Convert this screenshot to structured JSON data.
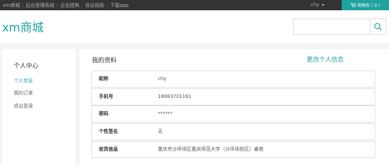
{
  "topbar": {
    "links": [
      "xm商城",
      "后台管理系统",
      "企业团购",
      "协议规则",
      "下载app"
    ],
    "user": "chy",
    "cart_label": "购物车 ( 0 )"
  },
  "header": {
    "logo": "xm商城",
    "search": {
      "value": "",
      "placeholder": ""
    }
  },
  "sidebar": {
    "title": "个人中心",
    "items": [
      {
        "label": "个人信息",
        "active": true
      },
      {
        "label": "我的订单",
        "active": false
      },
      {
        "label": "退出登录",
        "active": false
      }
    ]
  },
  "profile": {
    "title": "我的资料",
    "edit_label": "更改个人信息",
    "fields": [
      {
        "label": "昵称",
        "value": "chy"
      },
      {
        "label": "手机号",
        "value": "18883701161"
      },
      {
        "label": "密码",
        "value": "******"
      },
      {
        "label": "个性签名",
        "value": "无"
      },
      {
        "label": "收货信息",
        "value": "重庆市沙坪坝区重庆师范大学（沙坪坝校区）睿苑"
      }
    ]
  },
  "colors": {
    "accent": "#1fa39e",
    "topbar": "#333333"
  }
}
